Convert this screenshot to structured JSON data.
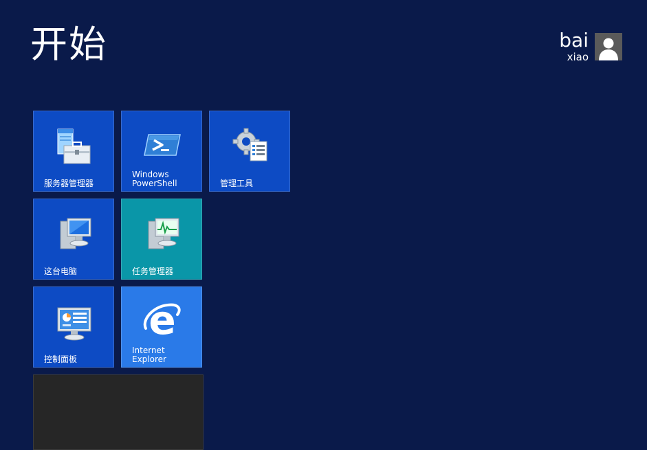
{
  "header": {
    "title": "开始"
  },
  "user": {
    "first_name": "bai",
    "last_name": "xiao",
    "avatar_icon": "user-silhouette-icon"
  },
  "tiles": [
    {
      "label": "服务器管理器",
      "icon": "server-manager-icon",
      "color": "#0d4bc4"
    },
    {
      "label": "Windows\nPowerShell",
      "icon": "powershell-icon",
      "color": "#0d4bc4"
    },
    {
      "label": "管理工具",
      "icon": "admin-tools-icon",
      "color": "#0d4bc4"
    },
    {
      "label": "这台电脑",
      "icon": "this-pc-icon",
      "color": "#0d4bc4"
    },
    {
      "label": "任务管理器",
      "icon": "task-manager-icon",
      "color": "#0a96a8"
    },
    {
      "label": "控制面板",
      "icon": "control-panel-icon",
      "color": "#0d4bc4"
    },
    {
      "label": "Internet\nExplorer",
      "icon": "internet-explorer-icon",
      "color": "#2a7ae8"
    },
    {
      "label": "",
      "icon": "",
      "color": "#262626"
    }
  ],
  "colors": {
    "background": "#0a1a4a",
    "tile_blue": "#0d4bc4",
    "tile_teal": "#0a96a8",
    "tile_ie": "#2a7ae8"
  }
}
